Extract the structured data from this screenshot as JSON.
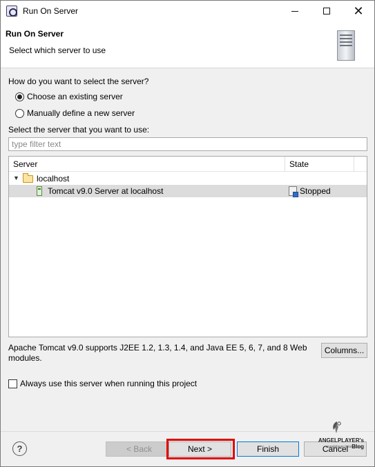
{
  "window": {
    "title": "Run On Server",
    "icon": "eclipse-gear-icon"
  },
  "banner": {
    "title": "Run On Server",
    "description": "Select which server to use",
    "graphic": "server-tower-icon"
  },
  "selection": {
    "question": "How do you want to select the server?",
    "options": [
      {
        "label": "Choose an existing server",
        "checked": true
      },
      {
        "label": "Manually define a new server",
        "checked": false
      }
    ],
    "server_prompt": "Select the server that you want to use:",
    "filter_placeholder": "type filter text",
    "filter_value": ""
  },
  "table": {
    "columns": [
      "Server",
      "State"
    ],
    "rows": [
      {
        "type": "group",
        "name": "localhost",
        "icon": "folder-icon",
        "expanded": true
      },
      {
        "type": "server",
        "name": "Tomcat v9.0 Server at localhost",
        "state": "Stopped",
        "selected": true,
        "icon": "tomcat-icon",
        "state_icon": "server-stopped-icon"
      }
    ]
  },
  "description": "Apache Tomcat v9.0 supports J2EE 1.2, 1.3, 1.4, and Java EE 5, 6, 7, and 8 Web modules.",
  "columns_button": "Columns...",
  "always_use": {
    "label": "Always use this server when running this project",
    "checked": false
  },
  "buttons": {
    "help": "?",
    "back": "< Back",
    "next": "Next >",
    "finish": "Finish",
    "cancel": "Cancel"
  },
  "watermark": {
    "title": "ANGELPLAYER's Blog",
    "url": "angelplayer.tistory.com"
  },
  "colors": {
    "highlight_box": "#e00000",
    "default_button_border": "#0078d7",
    "selected_row": "#dcdcdc"
  }
}
